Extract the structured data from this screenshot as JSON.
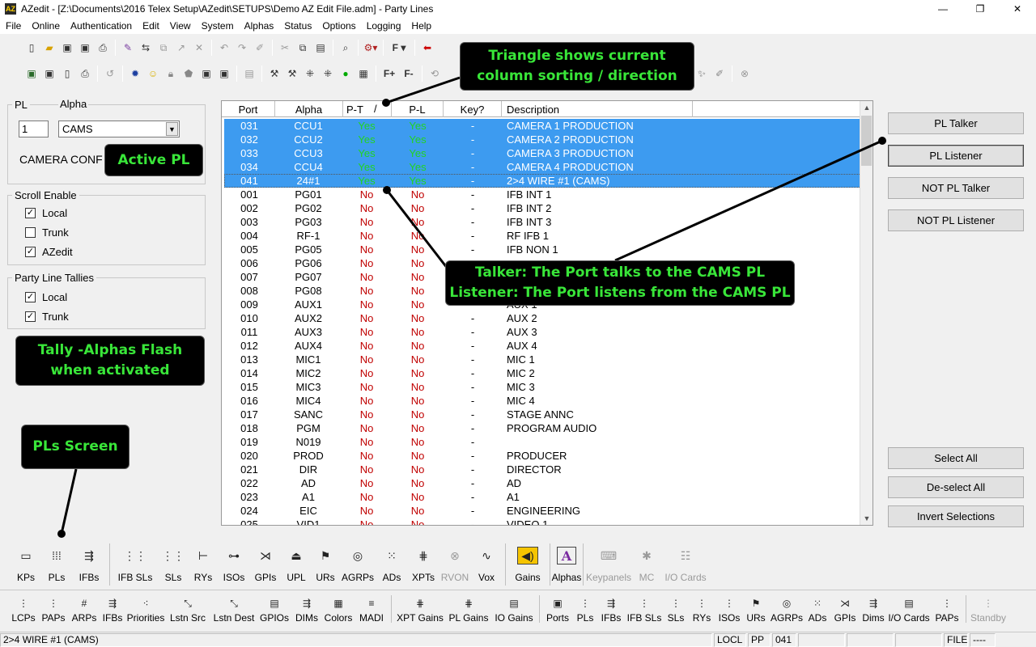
{
  "window": {
    "title": "AZedit - [Z:\\Documents\\2016 Telex Setup\\AZedit\\SETUPS\\Demo AZ Edit File.adm] - Party Lines",
    "controls": [
      "—",
      "❐",
      "✕"
    ]
  },
  "menu": [
    "File",
    "Online",
    "Authentication",
    "Edit",
    "View",
    "System",
    "Alphas",
    "Status",
    "Options",
    "Logging",
    "Help"
  ],
  "left_panel": {
    "pl_group_label": "PL",
    "alpha_group_label": "Alpha",
    "pl_number": "1",
    "alpha_value": "CAMS",
    "pl_name": "CAMERA CONF",
    "scroll_enable": {
      "label": "Scroll Enable",
      "items": [
        {
          "label": "Local",
          "checked": "✓"
        },
        {
          "label": "Trunk",
          "checked": ""
        },
        {
          "label": "AZedit",
          "checked": "✓"
        }
      ]
    },
    "tallies": {
      "label": "Party Line Tallies",
      "items": [
        {
          "label": "Local",
          "checked": "✓"
        },
        {
          "label": "Trunk",
          "checked": "✓"
        }
      ]
    }
  },
  "callouts": {
    "triangle": "Triangle shows current\ncolumn sorting / direction",
    "active_pl": "Active PL",
    "tally": "Tally -Alphas Flash\nwhen activated",
    "pls_screen": "PLs Screen",
    "talker": "Talker: The Port talks to the CAMS PL\nListener: The Port listens from the CAMS PL"
  },
  "grid": {
    "columns": [
      "Port",
      "Alpha",
      "P-T",
      "P-L",
      "Key?",
      "Description"
    ],
    "sort_indicator": "/",
    "rows": [
      [
        "031",
        "CCU1",
        "Yes",
        "Yes",
        "-",
        "CAMERA 1 PRODUCTION"
      ],
      [
        "032",
        "CCU2",
        "Yes",
        "Yes",
        "-",
        "CAMERA 2 PRODUCTION"
      ],
      [
        "033",
        "CCU3",
        "Yes",
        "Yes",
        "-",
        "CAMERA 3 PRODUCTION"
      ],
      [
        "034",
        "CCU4",
        "Yes",
        "Yes",
        "-",
        "CAMERA 4 PRODUCTION"
      ],
      [
        "041",
        "24#1",
        "Yes",
        "Yes",
        "-",
        "2>4 WIRE #1 (CAMS)"
      ],
      [
        "001",
        "PG01",
        "No",
        "No",
        "-",
        "IFB INT 1"
      ],
      [
        "002",
        "PG02",
        "No",
        "No",
        "-",
        "IFB INT 2"
      ],
      [
        "003",
        "PG03",
        "No",
        "No",
        "-",
        "IFB INT 3"
      ],
      [
        "004",
        "RF-1",
        "No",
        "No",
        "-",
        "RF IFB 1"
      ],
      [
        "005",
        "PG05",
        "No",
        "No",
        "-",
        "IFB NON 1"
      ],
      [
        "006",
        "PG06",
        "No",
        "No",
        "-",
        ""
      ],
      [
        "007",
        "PG07",
        "No",
        "No",
        "-",
        ""
      ],
      [
        "008",
        "PG08",
        "No",
        "No",
        "-",
        ""
      ],
      [
        "009",
        "AUX1",
        "No",
        "No",
        "-",
        "AUX 1"
      ],
      [
        "010",
        "AUX2",
        "No",
        "No",
        "-",
        "AUX 2"
      ],
      [
        "011",
        "AUX3",
        "No",
        "No",
        "-",
        "AUX 3"
      ],
      [
        "012",
        "AUX4",
        "No",
        "No",
        "-",
        "AUX 4"
      ],
      [
        "013",
        "MIC1",
        "No",
        "No",
        "-",
        "MIC 1"
      ],
      [
        "014",
        "MIC2",
        "No",
        "No",
        "-",
        "MIC 2"
      ],
      [
        "015",
        "MIC3",
        "No",
        "No",
        "-",
        "MIC 3"
      ],
      [
        "016",
        "MIC4",
        "No",
        "No",
        "-",
        "MIC 4"
      ],
      [
        "017",
        "SANC",
        "No",
        "No",
        "-",
        "STAGE ANNC"
      ],
      [
        "018",
        "PGM",
        "No",
        "No",
        "-",
        "PROGRAM AUDIO"
      ],
      [
        "019",
        "N019",
        "No",
        "No",
        "-",
        ""
      ],
      [
        "020",
        "PROD",
        "No",
        "No",
        "-",
        "PRODUCER"
      ],
      [
        "021",
        "DIR",
        "No",
        "No",
        "-",
        "DIRECTOR"
      ],
      [
        "022",
        "AD",
        "No",
        "No",
        "-",
        "AD"
      ],
      [
        "023",
        "A1",
        "No",
        "No",
        "-",
        "A1"
      ],
      [
        "024",
        "EIC",
        "No",
        "No",
        "-",
        "ENGINEERING"
      ],
      [
        "025",
        "VID1",
        "No",
        "No",
        "-",
        "VIDEO 1"
      ]
    ],
    "selected_count": 5
  },
  "right_buttons": {
    "pl_talker": "PL Talker",
    "pl_listener": "PL Listener",
    "not_pl_talker": "NOT PL Talker",
    "not_pl_listener": "NOT PL Listener",
    "select_all": "Select All",
    "deselect_all": "De-select All",
    "invert": "Invert Selections"
  },
  "big_toolbar": [
    {
      "label": "KPs",
      "icon": "▭"
    },
    {
      "label": "PLs",
      "icon": "⁞⁞⁞"
    },
    {
      "label": "IFBs",
      "icon": "⇶"
    },
    {
      "label": "IFB SLs",
      "icon": "⋮⋮"
    },
    {
      "label": "SLs",
      "icon": "⋮⋮"
    },
    {
      "label": "RYs",
      "icon": "⊢"
    },
    {
      "label": "ISOs",
      "icon": "⊶"
    },
    {
      "label": "GPIs",
      "icon": "⋊"
    },
    {
      "label": "UPL",
      "icon": "⏏"
    },
    {
      "label": "URs",
      "icon": "⚑"
    },
    {
      "label": "AGRPs",
      "icon": "◎"
    },
    {
      "label": "ADs",
      "icon": "⁙"
    },
    {
      "label": "XPTs",
      "icon": "⋕"
    },
    {
      "label": "RVON",
      "icon": "⊗",
      "disabled": true
    },
    {
      "label": "Vox",
      "icon": "∿"
    },
    {
      "label": "Gains",
      "icon": "◀)"
    },
    {
      "label": "Alphas",
      "icon": "A"
    },
    {
      "label": "Keypanels",
      "icon": "⌨",
      "disabled": true
    },
    {
      "label": "MC",
      "icon": "✱",
      "disabled": true
    },
    {
      "label": "I/O Cards",
      "icon": "☷",
      "disabled": true
    }
  ],
  "small_toolbar": [
    {
      "label": "LCPs",
      "icon": "⋮"
    },
    {
      "label": "PAPs",
      "icon": "⋮"
    },
    {
      "label": "ARPs",
      "icon": "#"
    },
    {
      "label": "IFBs",
      "icon": "⇶"
    },
    {
      "label": "Priorities",
      "icon": "⁖"
    },
    {
      "label": "Lstn Src",
      "icon": "⤡"
    },
    {
      "label": "Lstn Dest",
      "icon": "⤡"
    },
    {
      "label": "GPIOs",
      "icon": "▤"
    },
    {
      "label": "DIMs",
      "icon": "⇶"
    },
    {
      "label": "Colors",
      "icon": "▦"
    },
    {
      "label": "MADI",
      "icon": "≡"
    },
    {
      "label": "XPT Gains",
      "icon": "⋕"
    },
    {
      "label": "PL Gains",
      "icon": "⋕"
    },
    {
      "label": "IO Gains",
      "icon": "▤"
    },
    {
      "label": "Ports",
      "icon": "▣"
    },
    {
      "label": "PLs",
      "icon": "⋮"
    },
    {
      "label": "IFBs",
      "icon": "⇶"
    },
    {
      "label": "IFB SLs",
      "icon": "⋮"
    },
    {
      "label": "SLs",
      "icon": "⋮"
    },
    {
      "label": "RYs",
      "icon": "⋮"
    },
    {
      "label": "ISOs",
      "icon": "⋮"
    },
    {
      "label": "URs",
      "icon": "⚑"
    },
    {
      "label": "AGRPs",
      "icon": "◎"
    },
    {
      "label": "ADs",
      "icon": "⁙"
    },
    {
      "label": "GPIs",
      "icon": "⋊"
    },
    {
      "label": "Dims",
      "icon": "⇶"
    },
    {
      "label": "I/O Cards",
      "icon": "▤"
    },
    {
      "label": "PAPs",
      "icon": "⋮"
    },
    {
      "label": "Standby",
      "icon": "⋮",
      "disabled": true
    }
  ],
  "status": {
    "selection": "2>4 WIRE #1 (CAMS)",
    "mode": "LOCL",
    "type": "PP",
    "port": "041",
    "file": "FILE",
    "file_state": "----"
  },
  "colors": {
    "selection": "#3d9bf0",
    "yes": "#22d322",
    "no": "#c00000",
    "callout_bg": "#000000",
    "callout_text": "#39e639"
  }
}
